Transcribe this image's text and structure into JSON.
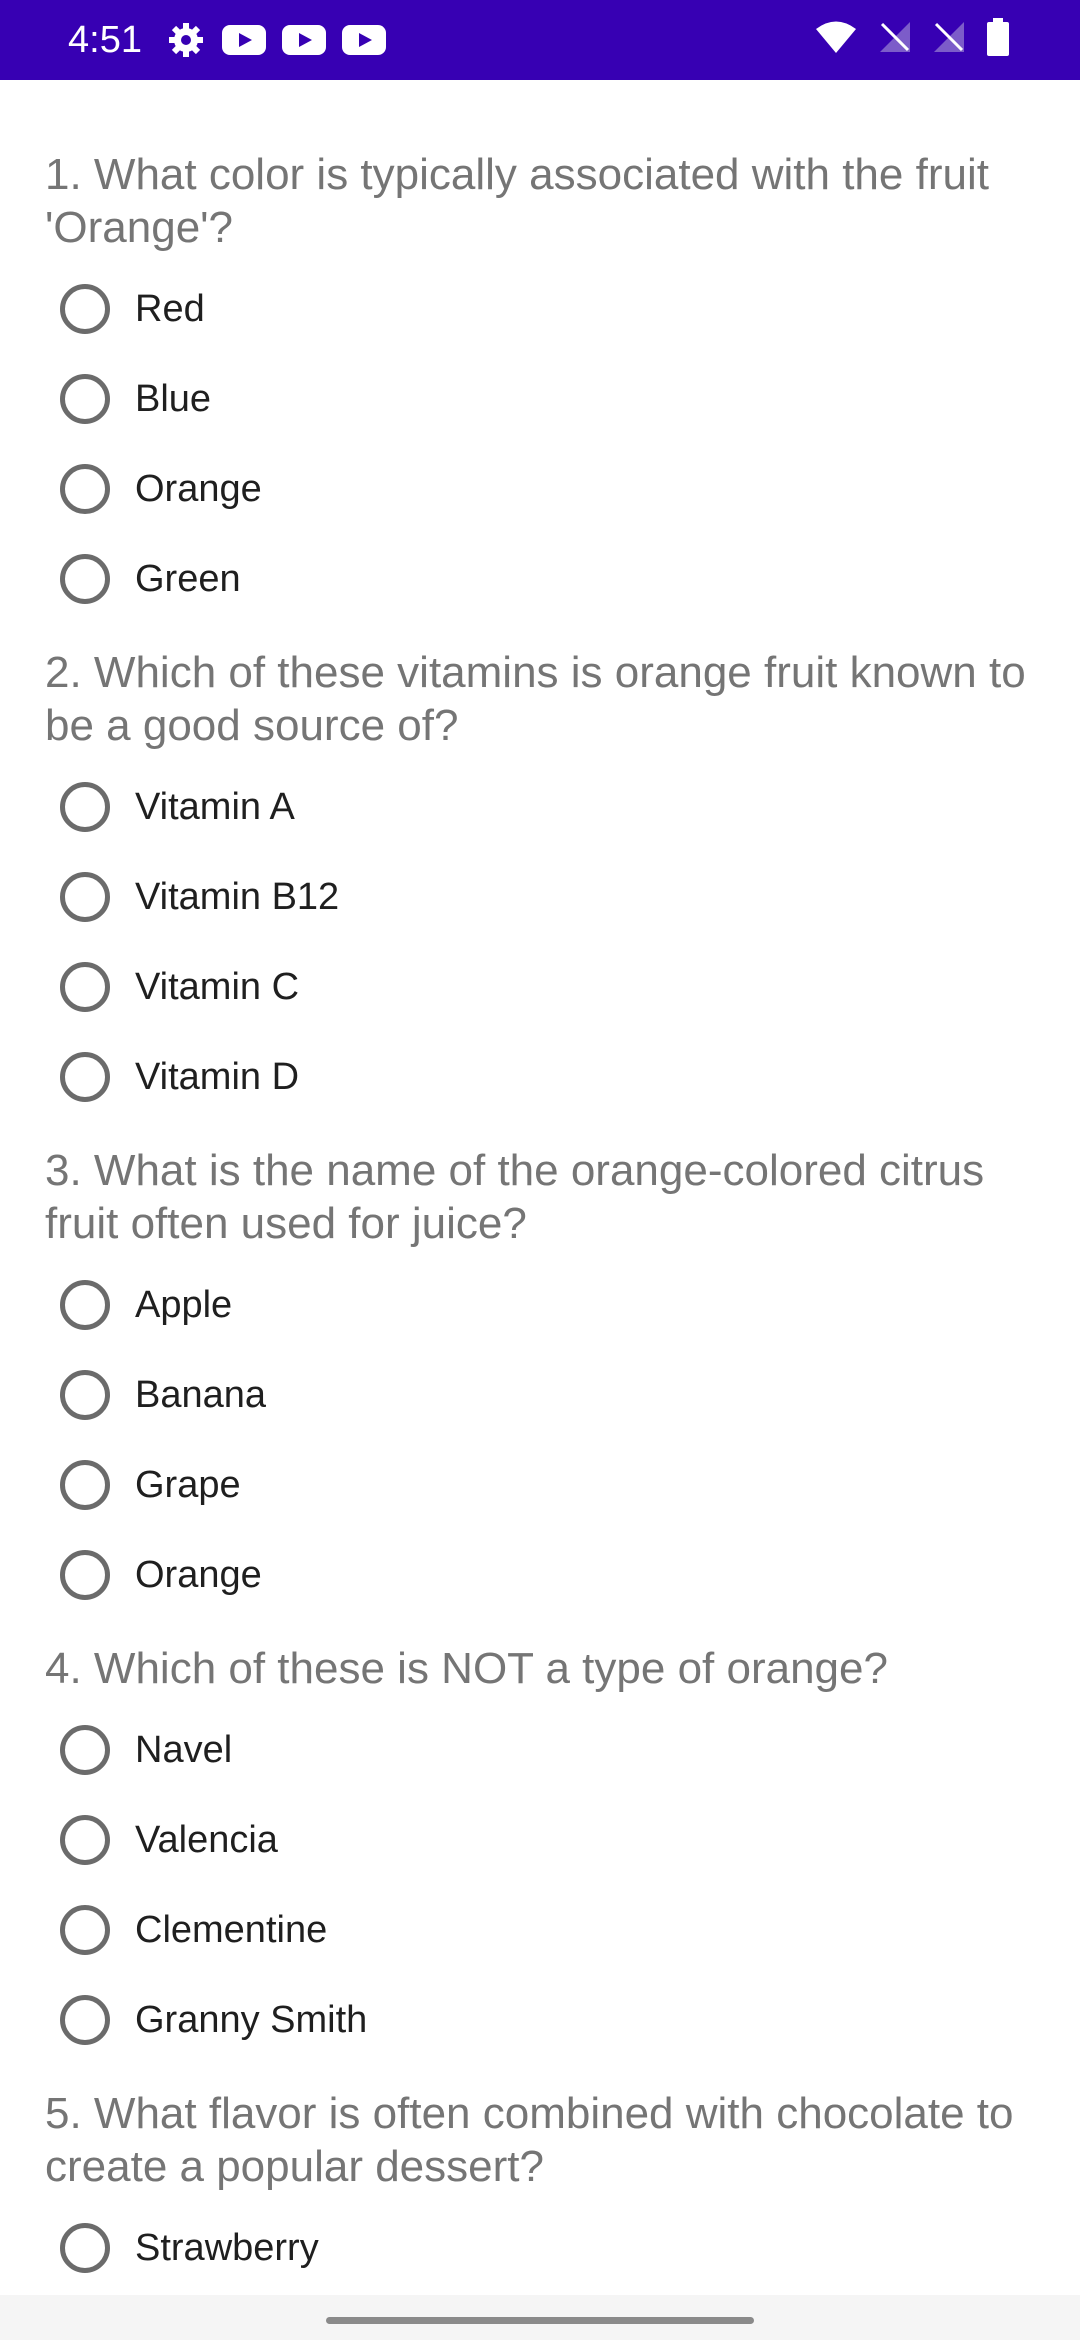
{
  "status_bar": {
    "time": "4:51",
    "left_icons": [
      "gear-icon",
      "youtube-icon",
      "youtube-icon",
      "youtube-icon"
    ],
    "right_icons": [
      "wifi-icon",
      "signal-off-icon",
      "signal-off-icon",
      "battery-icon"
    ],
    "background_color": "#3700b3"
  },
  "questions": [
    {
      "text": "1. What color is typically associated with the fruit 'Orange'?",
      "options": [
        "Red",
        "Blue",
        "Orange",
        "Green"
      ]
    },
    {
      "text": "2. Which of these vitamins is orange fruit known to be a good source of?",
      "options": [
        "Vitamin A",
        "Vitamin B12",
        "Vitamin C",
        "Vitamin D"
      ]
    },
    {
      "text": "3. What is the name of the orange-colored citrus fruit often used for juice?",
      "options": [
        "Apple",
        "Banana",
        "Grape",
        "Orange"
      ]
    },
    {
      "text": "4. Which of these is NOT a type of orange?",
      "options": [
        "Navel",
        "Valencia",
        "Clementine",
        "Granny Smith"
      ]
    },
    {
      "text": "5. What flavor is often combined with chocolate to create a popular dessert?",
      "options": [
        "Strawberry"
      ]
    }
  ]
}
